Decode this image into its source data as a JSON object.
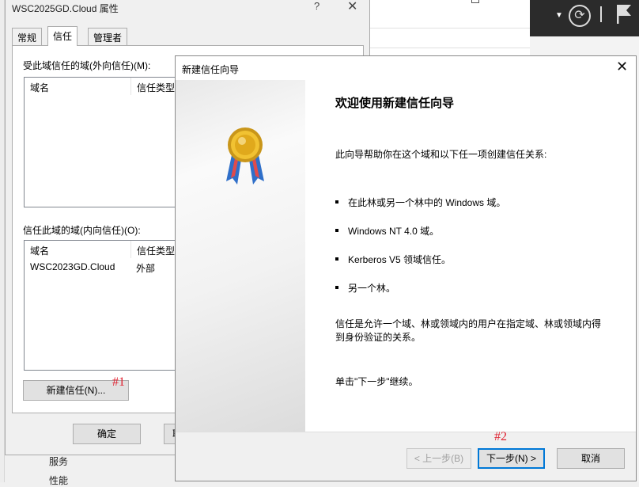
{
  "background": {
    "bottom_items": [
      "服务",
      "性能"
    ]
  },
  "props": {
    "title": "WSC2025GD.Cloud 属性",
    "help": "?",
    "close": "✕",
    "tabs": [
      "常规",
      "信任",
      "管理者"
    ],
    "outgoing": {
      "label": "受此域信任的域(外向信任)(M):",
      "col1": "域名",
      "col2": "信任类型"
    },
    "incoming": {
      "label": "信任此域的域(内向信任)(O):",
      "col1": "域名",
      "col2": "信任类型",
      "rows": [
        {
          "domain": "WSC2023GD.Cloud",
          "type": "外部"
        }
      ]
    },
    "new_trust_button": "新建信任(N)...",
    "ok_button": "确定",
    "peek_button": "取"
  },
  "annotations": {
    "a1": "#1",
    "a2": "#2"
  },
  "wizard": {
    "title": "新建信任向导",
    "close": "✕",
    "heading": "欢迎使用新建信任向导",
    "intro": "此向导帮助你在这个域和以下任一项创建信任关系:",
    "bullets": [
      "在此林或另一个林中的 Windows 域。",
      "Windows NT 4.0 域。",
      "Kerberos V5 领域信任。",
      "另一个林。"
    ],
    "desc_line1": "信任是允许一个域、林或领域内的用户在指定域、林或领域内得",
    "desc_line2": "到身份验证的关系。",
    "continue": "单击\"下一步\"继续。",
    "back_button": "< 上一步(B)",
    "next_button": "下一步(N) >",
    "cancel_button": "取消"
  }
}
